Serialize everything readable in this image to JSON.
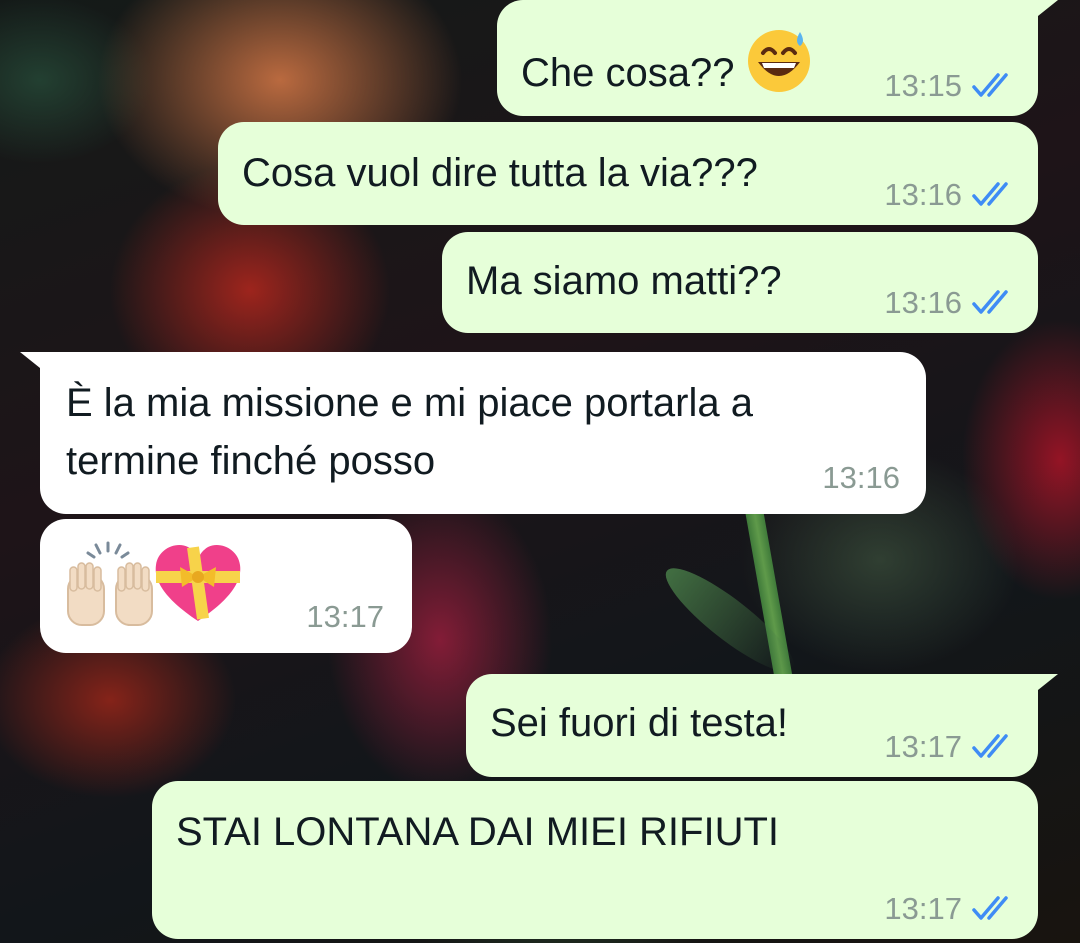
{
  "colors": {
    "outgoing_bubble": "#e6ffd9",
    "incoming_bubble": "#ffffff",
    "read_ticks": "#3f8cf5",
    "timestamp": "#8a9a93"
  },
  "messages": [
    {
      "direction": "outgoing",
      "text": "Che cosa??",
      "emoji": "grinning-sweat-face",
      "time": "13:15",
      "status": "read"
    },
    {
      "direction": "outgoing",
      "text": "Cosa vuol dire tutta la via???",
      "time": "13:16",
      "status": "read"
    },
    {
      "direction": "outgoing",
      "text": "Ma siamo matti??",
      "time": "13:16",
      "status": "read"
    },
    {
      "direction": "incoming",
      "text_line1": "È la mia missione e mi piace portarla a",
      "text_line2": "termine finché posso",
      "time": "13:16"
    },
    {
      "direction": "incoming",
      "emoji": "raising-hands + heart-with-ribbon",
      "time": "13:17"
    },
    {
      "direction": "outgoing",
      "text": "Sei fuori di testa!",
      "time": "13:17",
      "status": "read"
    },
    {
      "direction": "outgoing",
      "text": "STAI LONTANA DAI MIEI RIFIUTI",
      "time": "13:17",
      "status": "read"
    }
  ]
}
